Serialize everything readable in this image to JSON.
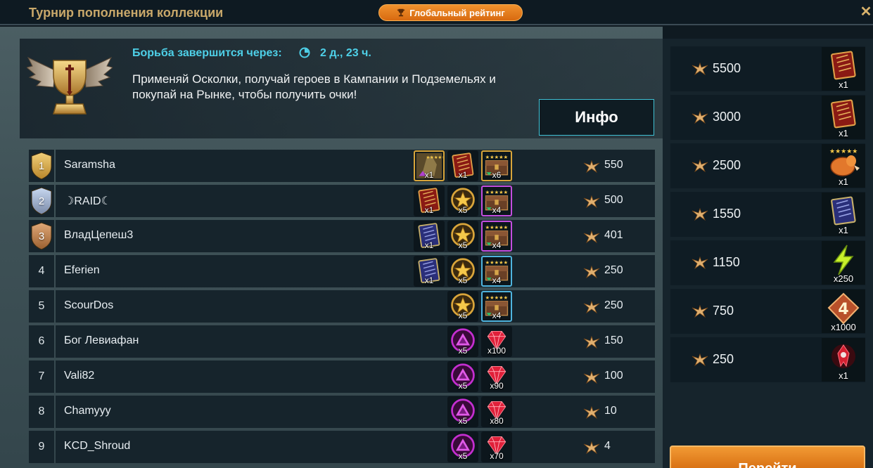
{
  "window": {
    "title": "Турнир пополнения коллекции",
    "global_rating_label": "Глобальный рейтинг",
    "close_label": "✕"
  },
  "header": {
    "ends_label": "Борьба завершится через:",
    "ends_value": "2 д., 23 ч.",
    "description": "Применяй Осколки, получай героев в Кампании и Подземельях и покупай на Рынке, чтобы получить очки!",
    "info_label": "Инфо"
  },
  "leaderboard": [
    {
      "rank": "1",
      "medal": "gold",
      "name": "Saramsha",
      "points": "550",
      "rewards": [
        {
          "icon": "sacred-shard-card",
          "qty": "x1",
          "frame": "gold"
        },
        {
          "icon": "red-tome",
          "qty": "x1",
          "frame": ""
        },
        {
          "icon": "chest-5star",
          "qty": "x6",
          "frame": "gold"
        }
      ]
    },
    {
      "rank": "2",
      "medal": "silver",
      "name": "☽RAID☾",
      "points": "500",
      "rewards": [
        {
          "icon": "red-tome",
          "qty": "x1",
          "frame": ""
        },
        {
          "icon": "gold-star-medal",
          "qty": "x5",
          "frame": ""
        },
        {
          "icon": "chest-5star",
          "qty": "x4",
          "frame": "purple"
        }
      ]
    },
    {
      "rank": "3",
      "medal": "bronze",
      "name": "ВладЦепеш3",
      "points": "401",
      "rewards": [
        {
          "icon": "blue-tome",
          "qty": "x1",
          "frame": ""
        },
        {
          "icon": "gold-star-medal",
          "qty": "x5",
          "frame": ""
        },
        {
          "icon": "chest-5star",
          "qty": "x4",
          "frame": "purple"
        }
      ]
    },
    {
      "rank": "4",
      "medal": "",
      "name": "Eferien",
      "points": "250",
      "rewards": [
        {
          "icon": "blue-tome",
          "qty": "x1",
          "frame": ""
        },
        {
          "icon": "gold-star-medal",
          "qty": "x5",
          "frame": ""
        },
        {
          "icon": "chest-5star",
          "qty": "x4",
          "frame": "blue"
        }
      ]
    },
    {
      "rank": "5",
      "medal": "",
      "name": "ScourDos",
      "points": "250",
      "rewards": [
        {
          "icon": "gold-star-medal",
          "qty": "x5",
          "frame": ""
        },
        {
          "icon": "chest-5star",
          "qty": "x4",
          "frame": "blue"
        }
      ]
    },
    {
      "rank": "6",
      "medal": "",
      "name": "Бог Левиафан",
      "points": "150",
      "rewards": [
        {
          "icon": "purple-rank-medal",
          "qty": "x5",
          "frame": ""
        },
        {
          "icon": "ruby-gem",
          "qty": "x100",
          "frame": ""
        }
      ]
    },
    {
      "rank": "7",
      "medal": "",
      "name": "Vali82",
      "points": "100",
      "rewards": [
        {
          "icon": "purple-rank-medal",
          "qty": "x5",
          "frame": ""
        },
        {
          "icon": "ruby-gem",
          "qty": "x90",
          "frame": ""
        }
      ]
    },
    {
      "rank": "8",
      "medal": "",
      "name": "Chamyyy",
      "points": "10",
      "rewards": [
        {
          "icon": "purple-rank-medal",
          "qty": "x5",
          "frame": ""
        },
        {
          "icon": "ruby-gem",
          "qty": "x80",
          "frame": ""
        }
      ]
    },
    {
      "rank": "9",
      "medal": "",
      "name": "KCD_Shroud",
      "points": "4",
      "rewards": [
        {
          "icon": "purple-rank-medal",
          "qty": "x5",
          "frame": ""
        },
        {
          "icon": "ruby-gem",
          "qty": "x70",
          "frame": ""
        }
      ]
    }
  ],
  "tiers": [
    {
      "points": "5500",
      "icon": "red-tome",
      "qty": "x1"
    },
    {
      "points": "3000",
      "icon": "red-tome",
      "qty": "x1"
    },
    {
      "points": "2500",
      "icon": "chicken-5star",
      "qty": "x1"
    },
    {
      "points": "1550",
      "icon": "blue-tome",
      "qty": "x1"
    },
    {
      "points": "1150",
      "icon": "energy-bolt",
      "qty": "x250"
    },
    {
      "points": "750",
      "icon": "rank-4-badge",
      "qty": "x1000"
    },
    {
      "points": "250",
      "icon": "red-crest-icon",
      "qty": "x1"
    }
  ],
  "go_button_label": "Перейти",
  "colors": {
    "accent_cyan": "#4ed0e8",
    "title_gold": "#c9a86a",
    "button_orange": "#e27a1e",
    "gold_frame": "#d8a53a",
    "purple_frame": "#c44ee0",
    "blue_frame": "#4fb4de"
  }
}
